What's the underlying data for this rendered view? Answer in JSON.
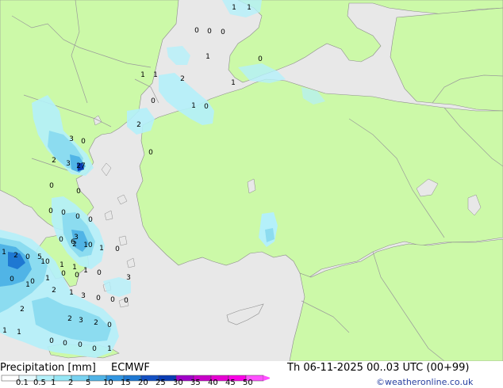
{
  "colors": {
    "sea": "#e8e8e8",
    "land": "#ccf9a8",
    "border": "#9a9a9a",
    "coast": "#8c8c8c",
    "precip_light": "#b4f0fa",
    "precip_mid": "#8cdcf0",
    "precip_heavy": "#50b4e6",
    "precip_very_heavy": "#1e78d2",
    "precip_core": "#0a3cb4"
  },
  "footer": {
    "title": "Precipitation [mm]",
    "model": "ECMWF",
    "valid_time": "Th 06-11-2025 00..03 UTC (00+99)",
    "credit": "©weatheronline.co.uk"
  },
  "legend": {
    "ticks": [
      "0.1",
      "0.5",
      "1",
      "2",
      "5",
      "10",
      "15",
      "20",
      "25",
      "30",
      "35",
      "40",
      "45",
      "50"
    ],
    "colors": [
      "#ffffff",
      "#e6fafe",
      "#b4f0fa",
      "#96e6f5",
      "#78d2f0",
      "#50b4e6",
      "#3296e1",
      "#1e78d2",
      "#1450c3",
      "#0a3cb4",
      "#a000c8",
      "#c800c8",
      "#e600d2",
      "#fa00e6",
      "#ff50ff"
    ]
  },
  "map_values": [
    {
      "text": "1"
    },
    {
      "text": "1"
    },
    {
      "text": "0"
    },
    {
      "text": "0"
    },
    {
      "text": "0"
    },
    {
      "text": "1"
    },
    {
      "text": "0"
    },
    {
      "text": "1"
    },
    {
      "text": "1"
    },
    {
      "text": "2"
    },
    {
      "text": "1"
    },
    {
      "text": "0"
    },
    {
      "text": "1"
    },
    {
      "text": "0"
    },
    {
      "text": "2"
    },
    {
      "text": "0"
    },
    {
      "text": "3"
    },
    {
      "text": "0"
    },
    {
      "text": "2"
    },
    {
      "text": "3"
    },
    {
      "text": "27"
    },
    {
      "text": "0"
    },
    {
      "text": "0"
    },
    {
      "text": "0"
    },
    {
      "text": "0"
    },
    {
      "text": "0"
    },
    {
      "text": "0"
    },
    {
      "text": "3"
    },
    {
      "text": "0"
    },
    {
      "text": "6"
    },
    {
      "text": "2"
    },
    {
      "text": "10"
    },
    {
      "text": "1"
    },
    {
      "text": "0"
    },
    {
      "text": "1"
    },
    {
      "text": "2"
    },
    {
      "text": "0"
    },
    {
      "text": "5"
    },
    {
      "text": "10"
    },
    {
      "text": "1"
    },
    {
      "text": "1"
    },
    {
      "text": "1"
    },
    {
      "text": "0"
    },
    {
      "text": "0"
    },
    {
      "text": "0"
    },
    {
      "text": "1"
    },
    {
      "text": "0"
    },
    {
      "text": "0"
    },
    {
      "text": "3"
    },
    {
      "text": "1"
    },
    {
      "text": "2"
    },
    {
      "text": "1"
    },
    {
      "text": "3"
    },
    {
      "text": "0"
    },
    {
      "text": "0"
    },
    {
      "text": "0"
    },
    {
      "text": "2"
    },
    {
      "text": "2"
    },
    {
      "text": "3"
    },
    {
      "text": "2"
    },
    {
      "text": "0"
    },
    {
      "text": "1"
    },
    {
      "text": "1"
    },
    {
      "text": "0"
    },
    {
      "text": "0"
    },
    {
      "text": "0"
    },
    {
      "text": "0"
    },
    {
      "text": "1"
    }
  ]
}
